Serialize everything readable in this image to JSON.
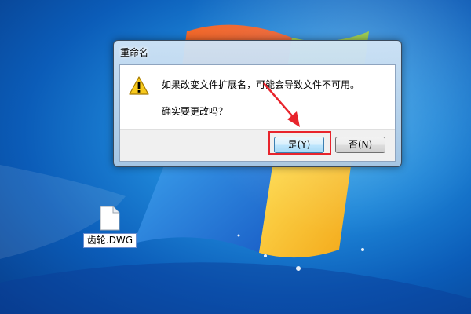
{
  "desktop": {
    "file_icon_name": "dwg-file-icon",
    "file_label": "齿轮.DWG"
  },
  "dialog": {
    "title": "重命名",
    "icon_name": "warning-icon",
    "message_line1": "如果改变文件扩展名，可能会导致文件不可用。",
    "message_line2": "确实要更改吗？",
    "yes_label": "是(Y)",
    "no_label": "否(N)"
  },
  "annotation": {
    "color": "#e8242c"
  }
}
